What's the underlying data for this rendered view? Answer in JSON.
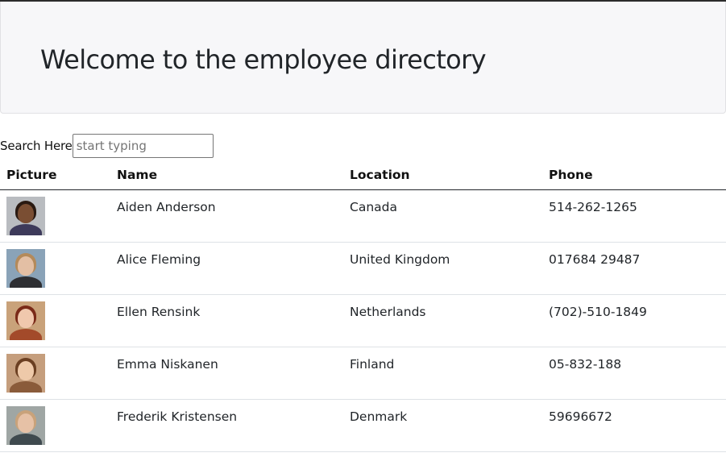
{
  "header": {
    "title": "Welcome to the employee directory"
  },
  "search": {
    "label": "Search Here",
    "placeholder": "start typing",
    "value": ""
  },
  "table": {
    "columns": [
      "Picture",
      "Name",
      "Location",
      "Phone"
    ],
    "rows": [
      {
        "name": "Aiden Anderson",
        "location": "Canada",
        "phone": "514-262-1265",
        "avatar_icon": "person-photo",
        "avatar_colors": {
          "bg": "#b9bcc0",
          "skin": "#7a4e33",
          "hair": "#2a1a12",
          "shirt": "#3d3a5a"
        }
      },
      {
        "name": "Alice Fleming",
        "location": "United Kingdom",
        "phone": "017684 29487",
        "avatar_icon": "person-photo",
        "avatar_colors": {
          "bg": "#8aa3b8",
          "skin": "#e3bfa4",
          "hair": "#b48a5a",
          "shirt": "#2e2f33"
        }
      },
      {
        "name": "Ellen Rensink",
        "location": "Netherlands",
        "phone": "(702)-510-1849",
        "avatar_icon": "person-photo",
        "avatar_colors": {
          "bg": "#c9a27a",
          "skin": "#f0c8ad",
          "hair": "#7a2a18",
          "shirt": "#a34a2a"
        }
      },
      {
        "name": "Emma Niskanen",
        "location": "Finland",
        "phone": "05-832-188",
        "avatar_icon": "person-photo",
        "avatar_colors": {
          "bg": "#c59e7d",
          "skin": "#eec9a9",
          "hair": "#6b3f22",
          "shirt": "#8a5b3a"
        }
      },
      {
        "name": "Frederik Kristensen",
        "location": "Denmark",
        "phone": "59696672",
        "avatar_icon": "person-photo",
        "avatar_colors": {
          "bg": "#9fa6a4",
          "skin": "#e6c1a6",
          "hair": "#c9a27a",
          "shirt": "#3f4a4f"
        }
      }
    ]
  }
}
